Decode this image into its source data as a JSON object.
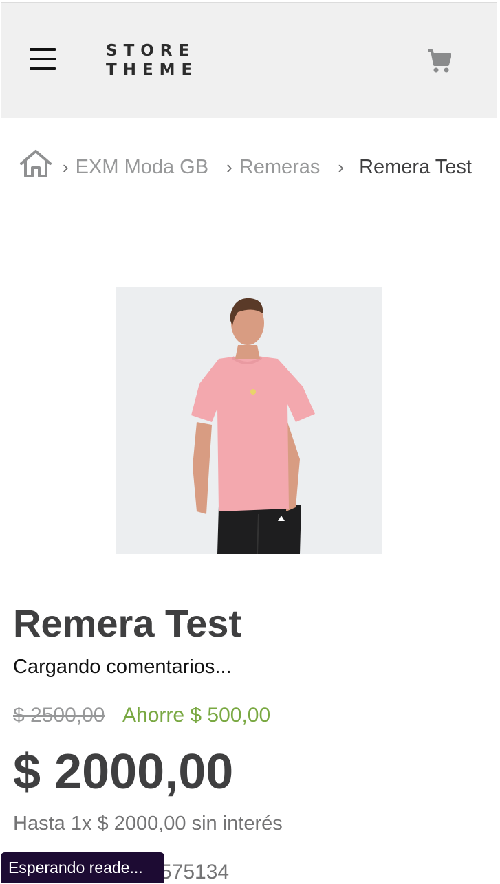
{
  "header": {
    "menu_icon": "hamburger-menu-icon",
    "logo_line1": "STORE",
    "logo_line2": "THEME",
    "cart_icon": "shopping-cart-icon"
  },
  "breadcrumb": {
    "home_icon": "home-icon",
    "separator": "›",
    "items": [
      {
        "label": "EXM Moda GB"
      },
      {
        "label": "Remeras"
      }
    ],
    "current": "Remera Test"
  },
  "product": {
    "name": "Remera Test",
    "reviews_status": "Cargando comentarios...",
    "list_price": "$ 2500,00",
    "savings": "Ahorre $ 500,00",
    "selling_price": "$ 2000,00",
    "installments": "Hasta 1x $ 2000,00 sin interés",
    "sku_partial": "575134"
  },
  "toast": {
    "text": "Esperando reade..."
  },
  "colors": {
    "header_bg": "#f0f0f0",
    "text_primary": "#3f3f40",
    "text_muted": "#979899",
    "savings_green": "#79a842",
    "toast_bg": "#1d0b33"
  }
}
